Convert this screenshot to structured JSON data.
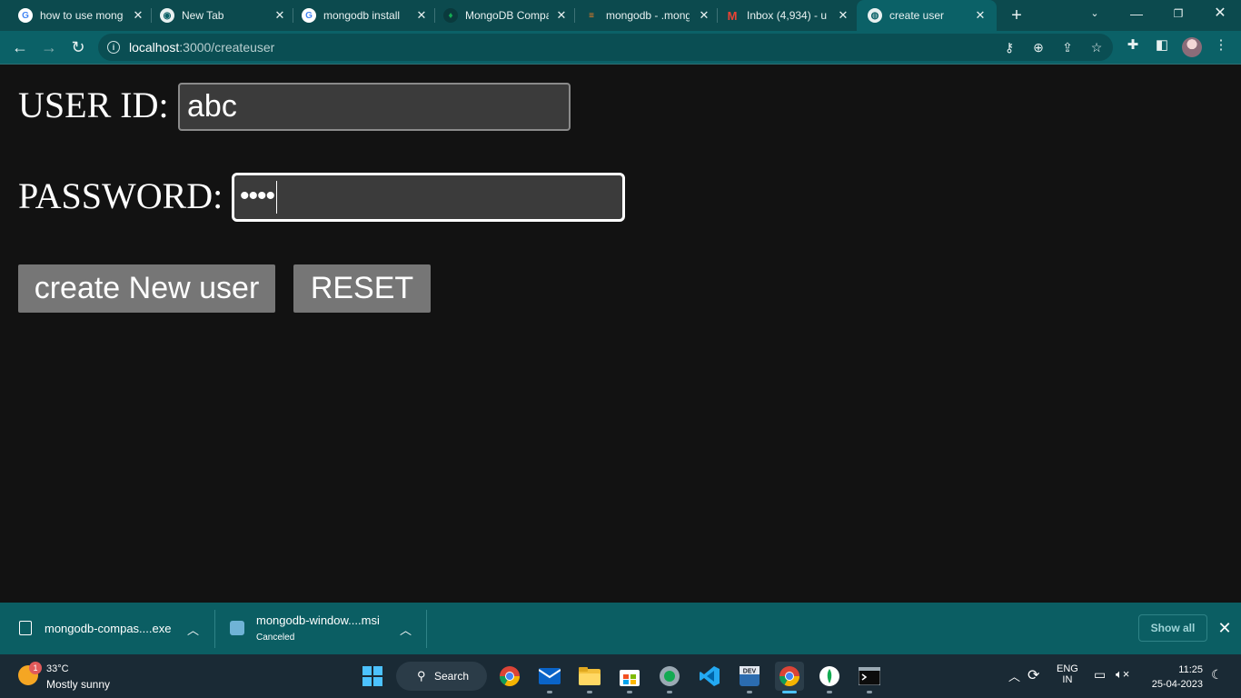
{
  "browser": {
    "tabs": [
      {
        "title": "how to use mongodb",
        "favicon": "google-icon",
        "active": false
      },
      {
        "title": "New Tab",
        "favicon": "chrome-icon",
        "active": false
      },
      {
        "title": "mongodb install",
        "favicon": "google-icon",
        "active": false
      },
      {
        "title": "MongoDB Compass",
        "favicon": "mongodb-leaf-icon",
        "active": false
      },
      {
        "title": "mongodb - .mongo",
        "favicon": "stackoverflow-icon",
        "active": false
      },
      {
        "title": "Inbox (4,934) - u",
        "favicon": "gmail-icon",
        "active": false
      },
      {
        "title": "create user",
        "favicon": "globe-icon",
        "active": true
      }
    ],
    "address_bar": {
      "host": "localhost",
      "path": ":3000/createuser"
    }
  },
  "page": {
    "userid_label": "USER ID:",
    "userid_value": "abc",
    "password_label": "PASSWORD:",
    "password_masked": "••••",
    "create_button": "create New user",
    "reset_button": "RESET"
  },
  "downloads": {
    "items": [
      {
        "name": "mongodb-compas....exe",
        "status": ""
      },
      {
        "name": "mongodb-window....msi",
        "status": "Canceled"
      }
    ],
    "show_all": "Show all"
  },
  "taskbar": {
    "weather_temp": "33°C",
    "weather_cond": "Mostly sunny",
    "weather_badge": "1",
    "search_label": "Search",
    "lang_line1": "ENG",
    "lang_line2": "IN",
    "time": "11:25",
    "date": "25-04-2023"
  },
  "colors": {
    "accent": "#0b6167",
    "page_bg": "#121212",
    "button_bg": "#767676"
  }
}
